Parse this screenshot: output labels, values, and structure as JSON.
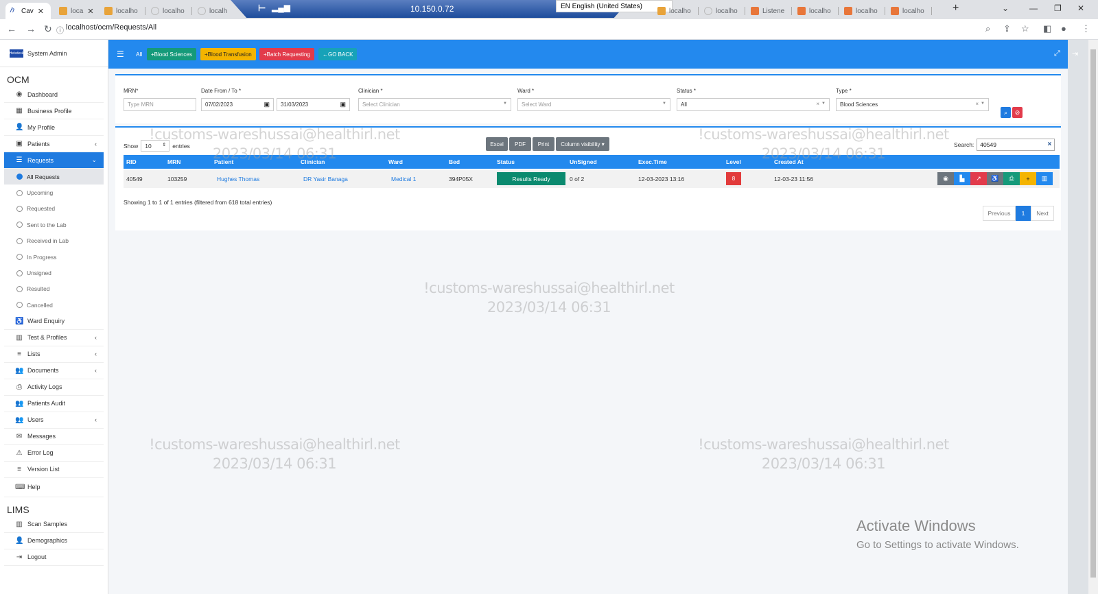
{
  "browser": {
    "tabs": [
      {
        "label": "Cav",
        "active": true
      },
      {
        "label": "loca"
      },
      {
        "label": "localho"
      },
      {
        "label": "localho"
      },
      {
        "label": "localh"
      },
      {
        "label": "localho"
      },
      {
        "label": "localho"
      },
      {
        "label": "Listene"
      },
      {
        "label": "localho"
      },
      {
        "label": "localho"
      },
      {
        "label": "localho"
      }
    ],
    "remote_ip": "10.150.0.72",
    "language": "EN English (United States)",
    "url": "localhost/ocm/Requests/All"
  },
  "sidebar": {
    "user": "System Admin",
    "logo_text": "Helsdesk",
    "section_ocm": "OCM",
    "section_lims": "LIMS",
    "items": [
      {
        "label": "Dashboard",
        "icon": "dashboard-icon"
      },
      {
        "label": "Business Profile",
        "icon": "building-icon"
      },
      {
        "label": "My Profile",
        "icon": "user-icon"
      },
      {
        "label": "Patients",
        "icon": "hospital-icon"
      },
      {
        "label": "Requests",
        "icon": "database-icon"
      }
    ],
    "sub_items": [
      "All Requests",
      "Upcoming",
      "Requested",
      "Sent to the Lab",
      "Received in Lab",
      "In Progress",
      "Unsigned",
      "Resulted",
      "Cancelled"
    ],
    "items2": [
      {
        "label": "Ward Enquiry",
        "icon": "wheelchair-icon"
      },
      {
        "label": "Test & Profiles",
        "icon": "columns-icon"
      },
      {
        "label": "Lists",
        "icon": "list-icon"
      },
      {
        "label": "Documents",
        "icon": "users-icon"
      },
      {
        "label": "Activity Logs",
        "icon": "printer-icon"
      },
      {
        "label": "Patients Audit",
        "icon": "users-icon"
      },
      {
        "label": "Users",
        "icon": "users-icon"
      },
      {
        "label": "Messages",
        "icon": "envelope-icon"
      },
      {
        "label": "Error Log",
        "icon": "warning-icon"
      },
      {
        "label": "Version List",
        "icon": "list-icon"
      },
      {
        "label": "Help",
        "icon": "keyboard-icon"
      }
    ],
    "lims_items": [
      {
        "label": "Scan Samples",
        "icon": "barcode-icon"
      },
      {
        "label": "Demographics",
        "icon": "user-icon"
      },
      {
        "label": "Logout",
        "icon": "logout-icon"
      }
    ]
  },
  "topnav": {
    "all_label": "All",
    "buttons": [
      {
        "label": "Blood Sciences",
        "color": "#159a7a"
      },
      {
        "label": "Blood Transfusion",
        "color": "#f4b400"
      },
      {
        "label": "Batch Requesting",
        "color": "#e23b4b"
      },
      {
        "label": "GO BACK",
        "color": "#17a2b8"
      }
    ]
  },
  "filters": {
    "mrn_label": "MRN*",
    "mrn_placeholder": "Type MRN",
    "date_label": "Date From / To *",
    "date_from": "07/02/2023",
    "date_to": "31/03/2023",
    "clinician_label": "Clinician *",
    "clinician_placeholder": "Select Clinician",
    "ward_label": "Ward *",
    "ward_placeholder": "Select Ward",
    "status_label": "Status *",
    "status_value": "All",
    "type_label": "Type *",
    "type_value": "Blood Sciences"
  },
  "table": {
    "show_label": "Show",
    "entries_value": "10",
    "entries_label": "entries",
    "export_buttons": [
      "Excel",
      "PDF",
      "Print",
      "Column visibility"
    ],
    "search_label": "Search:",
    "search_value": "40549",
    "columns": [
      "RID",
      "MRN",
      "Patient",
      "Clinician",
      "Ward",
      "Bed",
      "Status",
      "UnSigned",
      "Exec.Time",
      "Level",
      "Created At"
    ],
    "rows": [
      {
        "rid": "40549",
        "mrn": "103259",
        "patient": "Hughes Thomas",
        "clinician": "DR Yasir Banaga",
        "ward": "Medical 1",
        "bed": "394P05X",
        "status": "Results Ready",
        "unsigned": "0 of 2",
        "exec_time": "12-03-2023 13:16",
        "level": "8",
        "created_at": "12-03-23 11:56"
      }
    ],
    "info": "Showing 1 to 1 of 1 entries (filtered from 618 total entries)",
    "pager": {
      "previous": "Previous",
      "page": "1",
      "next": "Next"
    }
  },
  "watermark": {
    "line1": "!customs-wareshussai@healthirl.net",
    "line2": "2023/03/14 06:31"
  },
  "activation": {
    "title": "Activate Windows",
    "subtitle": "Go to Settings to activate Windows."
  }
}
